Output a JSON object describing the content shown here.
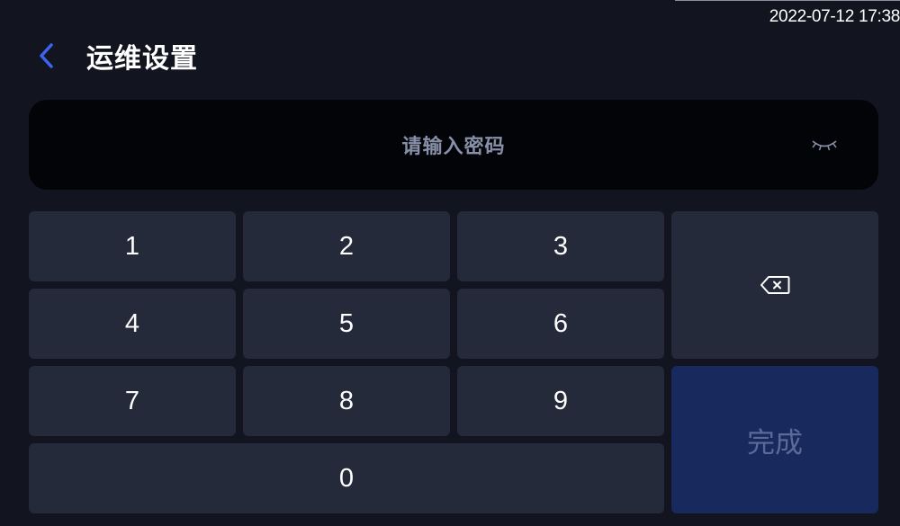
{
  "status": {
    "datetime": "2022-07-12 17:38"
  },
  "header": {
    "title": "运维设置",
    "back_icon": "chevron-left-icon",
    "accent": "#3d63f5"
  },
  "password": {
    "placeholder": "请输入密码",
    "toggle_icon": "eye-closed-icon"
  },
  "keypad": {
    "keys": [
      "1",
      "2",
      "3",
      "4",
      "5",
      "6",
      "7",
      "8",
      "9",
      "0"
    ],
    "backspace_icon": "backspace-icon",
    "done_label": "完成"
  },
  "colors": {
    "background": "#12151f",
    "key": "#252a3a",
    "done": "#18295e",
    "input": "#030407"
  }
}
